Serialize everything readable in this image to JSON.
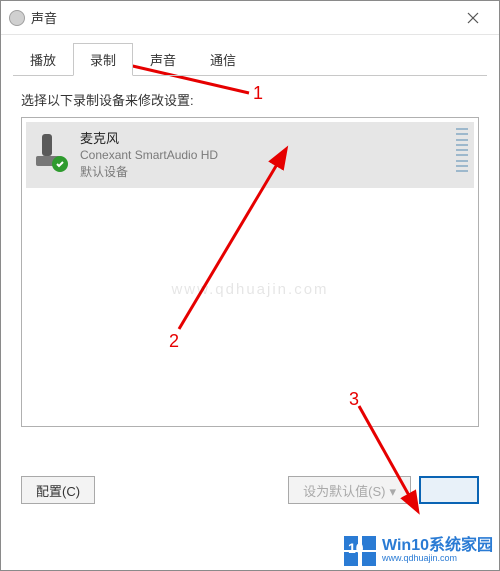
{
  "window": {
    "title": "声音"
  },
  "tabs": [
    {
      "label": "播放",
      "active": false
    },
    {
      "label": "录制",
      "active": true
    },
    {
      "label": "声音",
      "active": false
    },
    {
      "label": "通信",
      "active": false
    }
  ],
  "instruction": "选择以下录制设备来修改设置:",
  "device": {
    "name": "麦克风",
    "driver": "Conexant SmartAudio HD",
    "status": "默认设备",
    "check_icon": "check-icon"
  },
  "buttons": {
    "configure": "配置(C)",
    "set_default": "设为默认值(S)",
    "properties_partial": ""
  },
  "annotations": {
    "a1": "1",
    "a2": "2",
    "a3": "3"
  },
  "watermark": {
    "center": "www.qdhuajin.com",
    "brand": "Win10系统家园",
    "brand_sub": "www.qdhuajin.com"
  },
  "colors": {
    "annotation": "#e60000",
    "brand": "#2a7bd4"
  }
}
